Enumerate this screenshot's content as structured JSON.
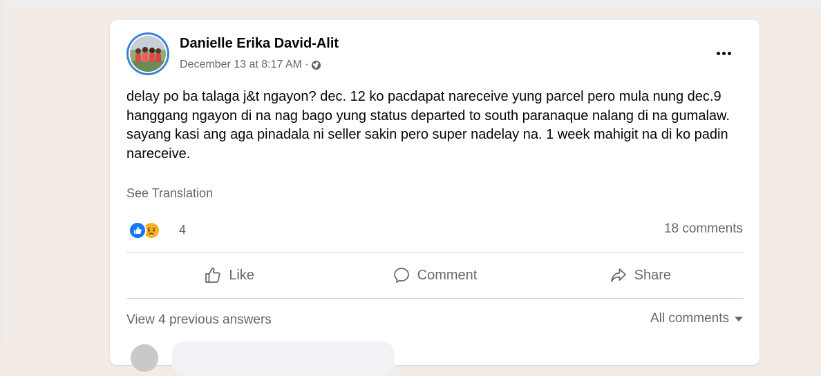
{
  "post": {
    "author": "Danielle Erika David-Alit",
    "date": "December 13 at 8:17 AM ·",
    "privacy_icon": "globe-icon",
    "more_icon": "more-options-icon",
    "text": "delay po ba talaga j&t ngayon? dec. 12 ko pacdapat nareceive yung parcel pero mula nung dec.9 hanggang ngayon di na nag bago yung status departed to south paranaque nalang di na gumalaw. sayang kasi ang aga pinadala ni seller sakin pero super nadelay na. 1 week mahigit na di ko padin nareceive.",
    "see_translation": "See Translation"
  },
  "reactions": {
    "types": [
      "like",
      "sad"
    ],
    "count": "4",
    "comments_count": "18 comments"
  },
  "actions": {
    "like_label": "Like",
    "comment_label": "Comment",
    "share_label": "Share"
  },
  "comments": {
    "view_previous": "View 4 previous answers",
    "filter_label": "All comments"
  },
  "colors": {
    "background": "#f3ebe6",
    "card": "#ffffff",
    "accent": "#1877f2",
    "secondary_text": "#65676b",
    "divider": "#ced0d4"
  }
}
